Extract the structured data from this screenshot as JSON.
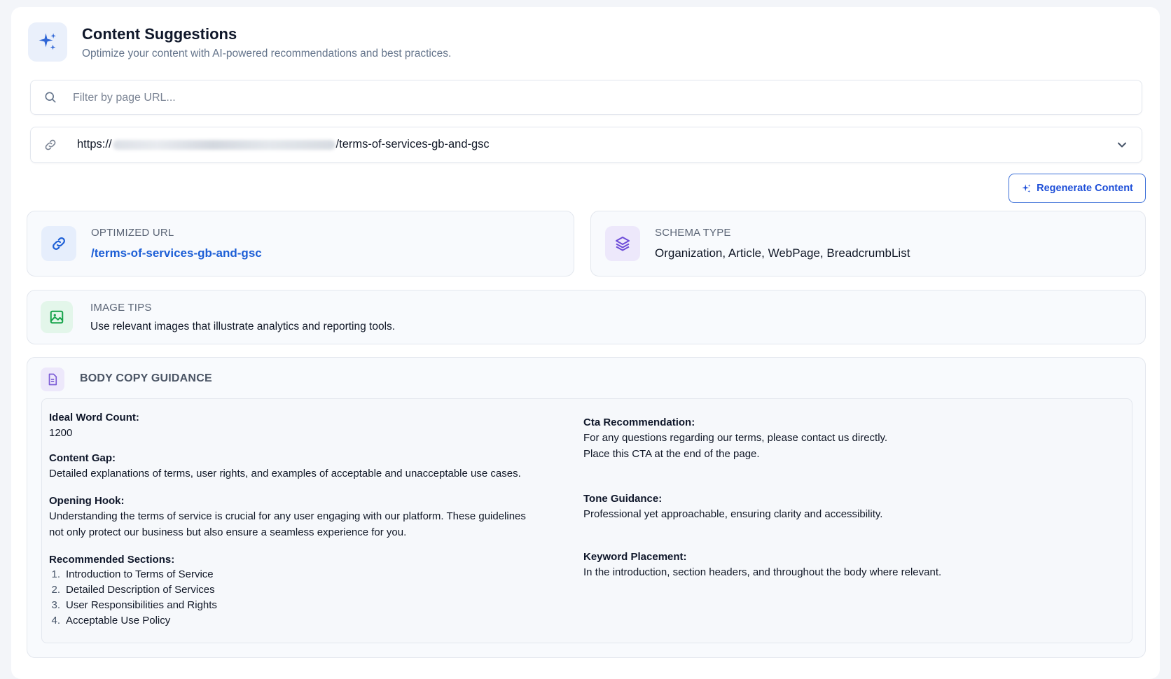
{
  "header": {
    "icon": "sparkles-icon",
    "title": "Content Suggestions",
    "subtitle": "Optimize your content with AI-powered recommendations and best practices."
  },
  "filter": {
    "placeholder": "Filter by page URL...",
    "value": ""
  },
  "page_select": {
    "url_prefix": "https://",
    "url_suffix": "/terms-of-services-gb-and-gsc"
  },
  "actions": {
    "regenerate_label": "Regenerate Content"
  },
  "optimized_url": {
    "label": "OPTIMIZED URL",
    "value": "/terms-of-services-gb-and-gsc"
  },
  "schema_type": {
    "label": "SCHEMA TYPE",
    "value": "Organization, Article, WebPage, BreadcrumbList"
  },
  "image_tips": {
    "label": "IMAGE TIPS",
    "value": "Use relevant images that illustrate analytics and reporting tools."
  },
  "body_copy": {
    "label": "BODY COPY GUIDANCE",
    "ideal_word_count": {
      "heading": "Ideal Word Count:",
      "text": "1200"
    },
    "content_gap": {
      "heading": "Content Gap:",
      "text": "Detailed explanations of terms, user rights, and examples of acceptable and unacceptable use cases."
    },
    "opening_hook": {
      "heading": "Opening Hook:",
      "line1": "Understanding the terms of service is crucial for any user engaging with our platform. These guidelines",
      "line2": "not only protect our business but also ensure a seamless experience for you."
    },
    "recommended_sections": {
      "heading": "Recommended Sections:",
      "items": [
        {
          "num": "1.",
          "text": "Introduction to Terms of Service"
        },
        {
          "num": "2.",
          "text": "Detailed Description of Services"
        },
        {
          "num": "3.",
          "text": "User Responsibilities and Rights"
        },
        {
          "num": "4.",
          "text": "Acceptable Use Policy"
        }
      ]
    },
    "cta_recommendation": {
      "heading": "Cta Recommendation:",
      "line1": "For any questions regarding our terms, please contact us directly.",
      "line2": "Place this CTA at the end of the page."
    },
    "tone_guidance": {
      "heading": "Tone Guidance:",
      "text": "Professional yet approachable, ensuring clarity and accessibility."
    },
    "keyword_placement": {
      "heading": "Keyword Placement:",
      "text": "In the introduction, section headers, and throughout the body where relevant."
    }
  },
  "colors": {
    "accent": "#1d5fd6",
    "schema_accent": "#6d4bd8",
    "image_accent": "#16a34a",
    "doc_accent": "#7c5cd6"
  }
}
